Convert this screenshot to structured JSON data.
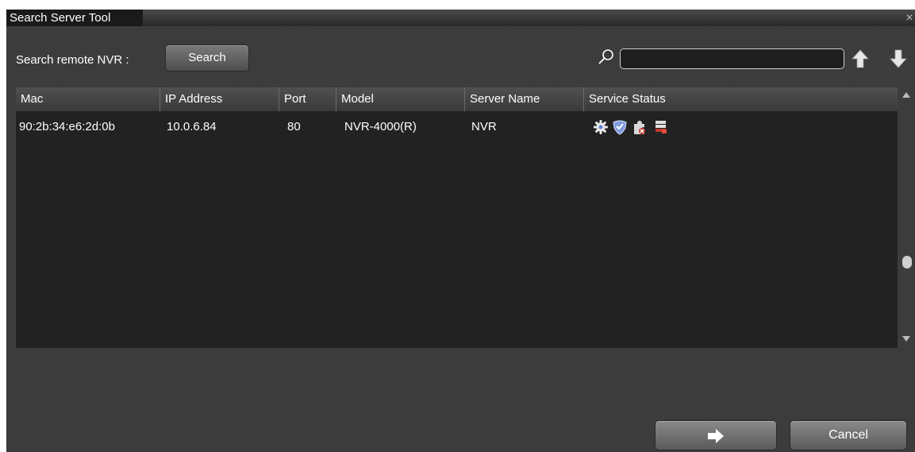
{
  "window": {
    "title": "Search Server Tool",
    "close_glyph": "×"
  },
  "toolbar": {
    "search_label": "Search remote NVR :",
    "search_button_label": "Search",
    "filter_value": "",
    "icons": [
      "magnifier-icon",
      "arrow-up-icon",
      "arrow-down-icon"
    ]
  },
  "table": {
    "columns": [
      "Mac",
      "IP Address",
      "Port",
      "Model",
      "Server Name",
      "Service Status"
    ],
    "rows": [
      {
        "mac": "90:2b:34:e6:2d:0b",
        "ip": "10.0.6.84",
        "port": "80",
        "model": "NVR-4000(R)",
        "server_name": "NVR",
        "status_icons": [
          "gear-icon",
          "shield-icon",
          "puzzle-icon",
          "server-icon"
        ]
      }
    ]
  },
  "footer": {
    "next_icon": "arrow-right-icon",
    "cancel_label": "Cancel"
  },
  "colors": {
    "window_bg": "#3c3c3c",
    "table_bg": "#222222",
    "header_bg": "#444444",
    "text": "#ffffff",
    "accent_red": "#c0392b",
    "accent_blue": "#5b7fd4"
  }
}
